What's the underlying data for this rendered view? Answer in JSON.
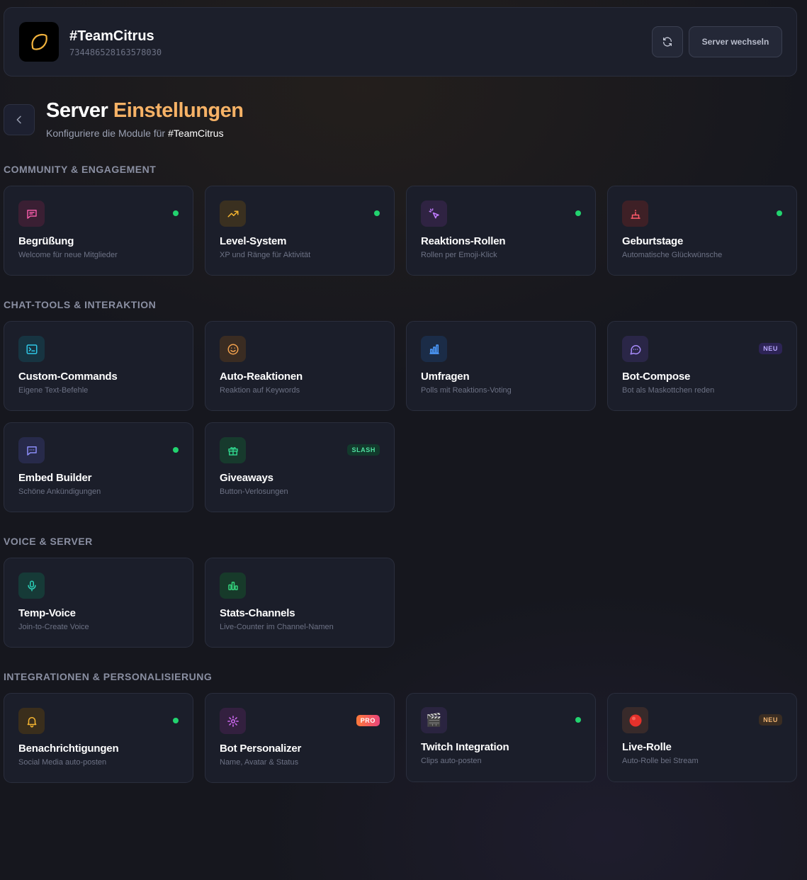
{
  "header": {
    "server_name": "#TeamCitrus",
    "server_id": "734486528163578030",
    "switch_label": "Server wechseln"
  },
  "page": {
    "title_prefix": "Server",
    "title_accent": "Einstellungen",
    "subtitle_prefix": "Konfiguriere die Module für",
    "subtitle_server": "#TeamCitrus"
  },
  "colors": {
    "accent": "#f6b266",
    "active_dot": "#22d36f",
    "card_bg": "#1b1e2a"
  },
  "sections": [
    {
      "label": "Community & Engagement",
      "cards": [
        {
          "title": "Begrüßung",
          "desc": "Welcome für neue Mitglieder",
          "icon": "message-square-icon",
          "active": true
        },
        {
          "title": "Level-System",
          "desc": "XP und Ränge für Aktivität",
          "icon": "trending-up-icon",
          "active": true
        },
        {
          "title": "Reaktions-Rollen",
          "desc": "Rollen per Emoji-Klick",
          "icon": "mouse-pointer-click-icon",
          "active": true
        },
        {
          "title": "Geburtstage",
          "desc": "Automatische Glückwünsche",
          "icon": "cake-icon",
          "active": true
        }
      ]
    },
    {
      "label": "Chat-Tools & Interaktion",
      "cards": [
        {
          "title": "Custom-Commands",
          "desc": "Eigene Text-Befehle",
          "icon": "terminal-icon",
          "active": false
        },
        {
          "title": "Auto-Reaktionen",
          "desc": "Reaktion auf Keywords",
          "icon": "smile-icon",
          "active": false
        },
        {
          "title": "Umfragen",
          "desc": "Polls mit Reaktions-Voting",
          "icon": "bar-chart-icon",
          "active": false
        },
        {
          "title": "Bot-Compose",
          "desc": "Bot als Maskottchen reden",
          "icon": "message-circle-icon",
          "active": false,
          "badge": "NEU"
        },
        {
          "title": "Embed Builder",
          "desc": "Schöne Ankündigungen",
          "icon": "message-square-more-icon",
          "active": true
        },
        {
          "title": "Giveaways",
          "desc": "Button-Verlosungen",
          "icon": "gift-icon",
          "active": false,
          "badge": "SLASH"
        }
      ]
    },
    {
      "label": "Voice & Server",
      "cards": [
        {
          "title": "Temp-Voice",
          "desc": "Join-to-Create Voice",
          "icon": "microphone-icon",
          "active": false
        },
        {
          "title": "Stats-Channels",
          "desc": "Live-Counter im Channel-Namen",
          "icon": "stats-bars-icon",
          "active": false
        }
      ]
    },
    {
      "label": "Integrationen & Personalisierung",
      "cards": [
        {
          "title": "Benachrichtigungen",
          "desc": "Social Media auto-posten",
          "icon": "bell-icon",
          "active": true
        },
        {
          "title": "Bot Personalizer",
          "desc": "Name, Avatar & Status",
          "icon": "gear-icon",
          "active": false,
          "badge": "PRO"
        },
        {
          "title": "Twitch Integration",
          "desc": "Clips auto-posten",
          "icon": "clapper-board-icon",
          "active": true
        },
        {
          "title": "Live-Rolle",
          "desc": "Auto-Rolle bei Stream",
          "icon": "red-circle-icon",
          "active": false,
          "badge": "NEU"
        }
      ]
    }
  ]
}
